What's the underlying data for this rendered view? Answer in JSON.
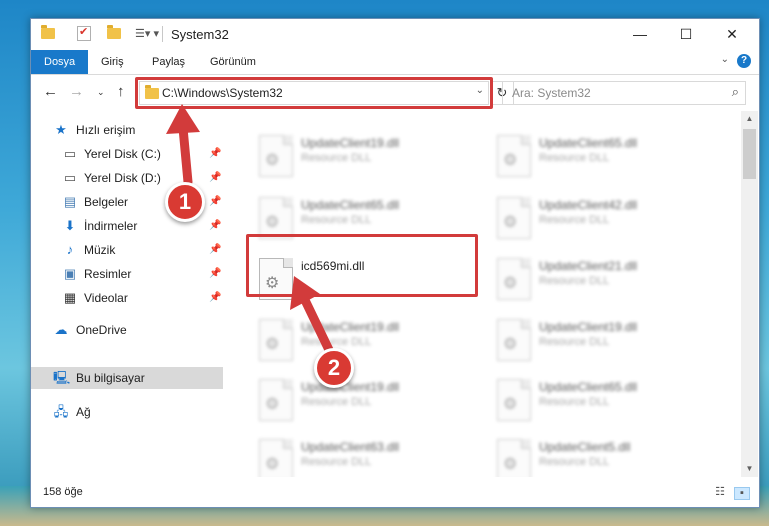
{
  "window": {
    "title": "System32",
    "controls": {
      "minimize": "—",
      "maximize": "☐",
      "close": "✕"
    }
  },
  "ribbon": {
    "tabs": [
      {
        "label": "Dosya",
        "active": true
      },
      {
        "label": "Giriş"
      },
      {
        "label": "Paylaş"
      },
      {
        "label": "Görünüm"
      }
    ],
    "help": "?"
  },
  "nav": {
    "address": "C:\\Windows\\System32",
    "search_placeholder": "Ara: System32"
  },
  "sidebar": {
    "items": [
      {
        "label": "Hızlı erişim",
        "icon": "star-icon"
      },
      {
        "label": "Yerel Disk (C:)",
        "icon": "drive-icon",
        "pinned": true
      },
      {
        "label": "Yerel Disk (D:)",
        "icon": "drive-icon",
        "pinned": true
      },
      {
        "label": "Belgeler",
        "icon": "documents-icon",
        "pinned": true
      },
      {
        "label": "İndirmeler",
        "icon": "download-icon",
        "pinned": true
      },
      {
        "label": "Müzik",
        "icon": "music-icon",
        "pinned": true
      },
      {
        "label": "Resimler",
        "icon": "pictures-icon",
        "pinned": true
      },
      {
        "label": "Videolar",
        "icon": "videos-icon",
        "pinned": true
      },
      {
        "label": "OneDrive",
        "icon": "cloud-icon"
      },
      {
        "label": "Bu bilgisayar",
        "icon": "computer-icon",
        "selected": true
      },
      {
        "label": "Ağ",
        "icon": "network-icon"
      }
    ]
  },
  "files": [
    {
      "name": "UpdateClient19.dll",
      "type": "Resource DLL",
      "highlight": false
    },
    {
      "name": "UpdateClient65.dll",
      "type": "Resource DLL",
      "highlight": false
    },
    {
      "name": "UpdateClient65.dll",
      "type": "Resource DLL",
      "highlight": false
    },
    {
      "name": "UpdateClient42.dll",
      "type": "Resource DLL",
      "highlight": false
    },
    {
      "name": "icd569mi.dll",
      "type": "",
      "highlight": true
    },
    {
      "name": "UpdateClient21.dll",
      "type": "Resource DLL",
      "highlight": false
    },
    {
      "name": "UpdateClient19.dll",
      "type": "Resource DLL",
      "highlight": false
    },
    {
      "name": "UpdateClient19.dll",
      "type": "Resource DLL",
      "highlight": false
    },
    {
      "name": "UpdateClient19.dll",
      "type": "Resource DLL",
      "highlight": false
    },
    {
      "name": "UpdateClient65.dll",
      "type": "Resource DLL",
      "highlight": false
    },
    {
      "name": "UpdateClient63.dll",
      "type": "Resource DLL",
      "highlight": false
    },
    {
      "name": "UpdateClient5.dll",
      "type": "Resource DLL",
      "highlight": false
    }
  ],
  "status": {
    "count": "158 öğe"
  },
  "annotations": {
    "step1": "1",
    "step2": "2",
    "color": "#d23b3b"
  }
}
